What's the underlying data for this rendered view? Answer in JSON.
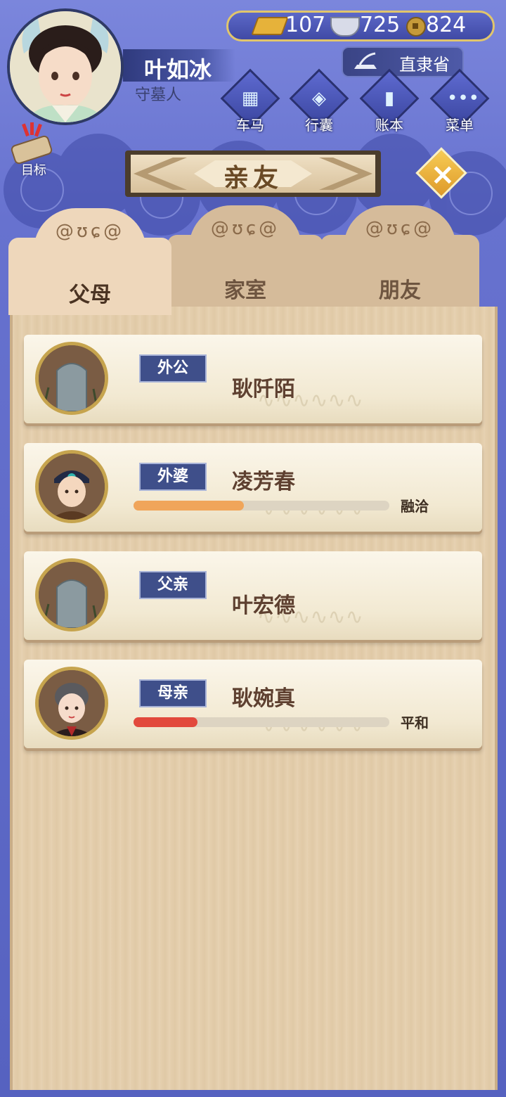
{
  "player": {
    "name": "叶如冰",
    "title": "守墓人"
  },
  "currency": {
    "gold": "107",
    "silver": "725",
    "coin": "824"
  },
  "location": "直隶省",
  "menu": [
    {
      "label": "车马",
      "icon": "carriage-icon"
    },
    {
      "label": "行囊",
      "icon": "bag-icon"
    },
    {
      "label": "账本",
      "icon": "ledger-icon"
    },
    {
      "label": "菜单",
      "icon": "more-icon"
    }
  ],
  "goal_label": "目标",
  "page_title": "亲友",
  "tabs": [
    {
      "label": "父母",
      "active": true
    },
    {
      "label": "家室",
      "active": false
    },
    {
      "label": "朋友",
      "active": false
    }
  ],
  "relatives": [
    {
      "relation": "外公",
      "name": "耿阡陌",
      "portrait": "tombstone",
      "has_bar": false
    },
    {
      "relation": "外婆",
      "name": "凌芳春",
      "portrait": "elder-woman",
      "has_bar": true,
      "status": "融洽",
      "level": 0.43,
      "bar_color": "#f0a55a"
    },
    {
      "relation": "父亲",
      "name": "叶宏德",
      "portrait": "tombstone",
      "has_bar": false
    },
    {
      "relation": "母亲",
      "name": "耿婉真",
      "portrait": "woman",
      "has_bar": true,
      "status": "平和",
      "level": 0.25,
      "bar_color": "#e2493c"
    }
  ]
}
